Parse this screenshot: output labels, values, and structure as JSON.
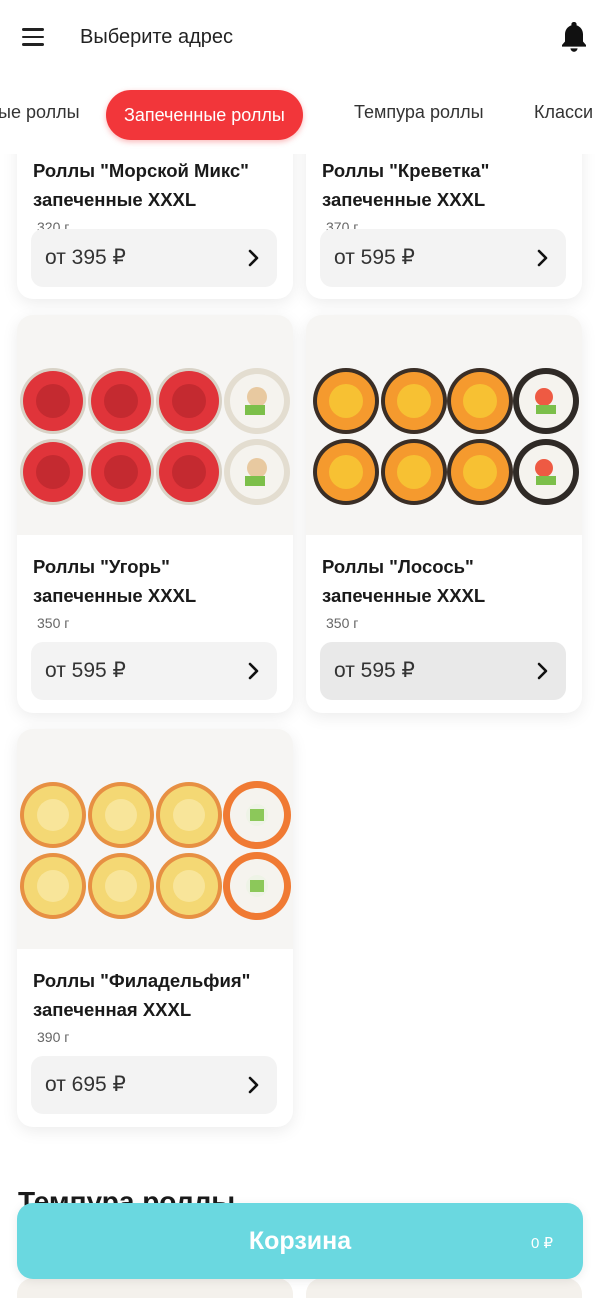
{
  "header": {
    "address_prompt": "Выберите адрес",
    "menu_icon": "hamburger-menu-icon",
    "bell_icon": "bell-icon"
  },
  "categories": {
    "items": [
      "ые роллы",
      "Запеченные роллы",
      "Темпура роллы",
      "Класси"
    ],
    "active": "Запеченные роллы",
    "active_color": "#f2363a"
  },
  "products": [
    {
      "title_line1": "Роллы \"Морской Микс\"",
      "title_line2": "запеченные XXXL",
      "weight": "320 г",
      "price": "от 395 ₽"
    },
    {
      "title_line1": "Роллы \"Креветка\"",
      "title_line2": "запеченные XXXL",
      "weight": "370 г",
      "price": "от 595 ₽"
    },
    {
      "title_line1": "Роллы \"Угорь\"",
      "title_line2": "запеченные XXXL",
      "weight": "350 г",
      "price": "от 595 ₽"
    },
    {
      "title_line1": "Роллы \"Лосось\"",
      "title_line2": "запеченные XXXL",
      "weight": "350 г",
      "price": "от 595 ₽"
    },
    {
      "title_line1": "Роллы \"Филадельфия\"",
      "title_line2": "запеченная XXXL",
      "weight": "390 г",
      "price": "от 695 ₽"
    }
  ],
  "next_section_title": "Темпура роллы",
  "cart": {
    "label": "Корзина",
    "sum": "0 ₽",
    "color": "#6ad8e0"
  }
}
